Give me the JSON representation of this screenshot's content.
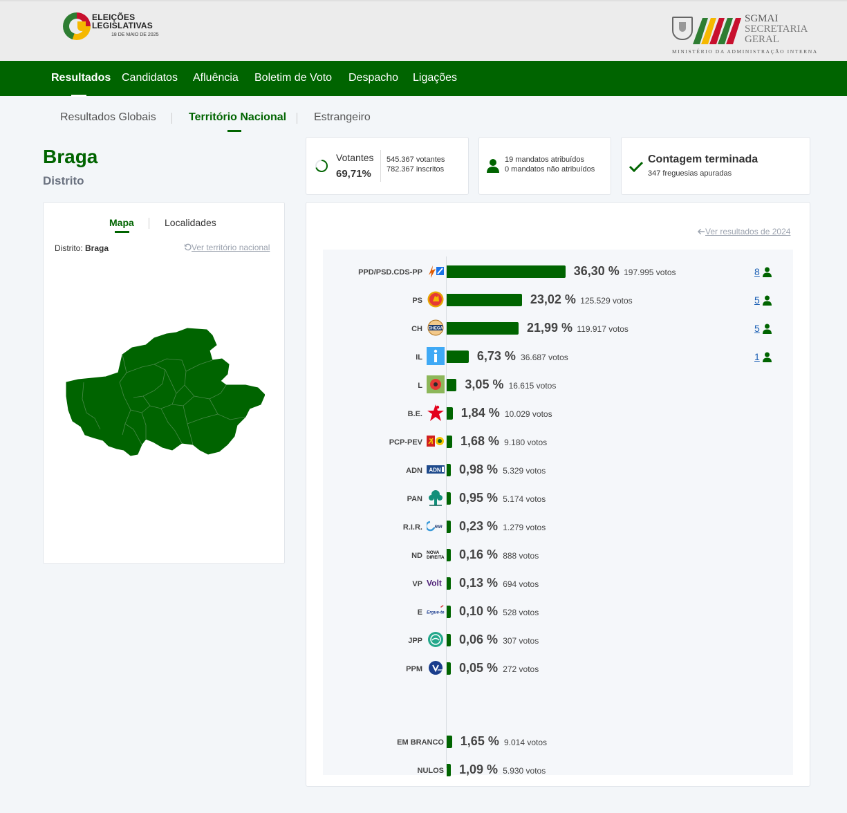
{
  "header": {
    "logo_line1": "ELEIÇÕES",
    "logo_line2": "LEGISLATIVAS",
    "logo_date": "18 DE MAIO DE 2025",
    "org_short": "SGMAI",
    "org_line2": "SECRETARIA",
    "org_line3": "GERAL",
    "org_ministry": "MINISTÉRIO DA ADMINISTRAÇÃO INTERNA"
  },
  "nav": {
    "items": [
      "Resultados",
      "Candidatos",
      "Afluência",
      "Boletim de Voto",
      "Despacho",
      "Ligações"
    ],
    "active": "Resultados"
  },
  "subtabs": {
    "items": [
      "Resultados Globais",
      "Território Nacional",
      "Estrangeiro"
    ],
    "active": "Território Nacional"
  },
  "region": {
    "title": "Braga",
    "subtitle": "Distrito"
  },
  "stats": {
    "votantes_label": "Votantes",
    "votantes_pct": "69,71%",
    "votantes_count": "545.367 votantes",
    "inscritos_count": "782.367 inscritos",
    "mandatos_atribuidos": "19 mandatos atribuídos",
    "mandatos_nao_atribuidos": "0 mandatos não atribuídos",
    "contagem_title": "Contagem terminada",
    "contagem_sub": "347 freguesias apuradas"
  },
  "map_panel": {
    "tabs": [
      "Mapa",
      "Localidades"
    ],
    "active": "Mapa",
    "district_label": "Distrito:",
    "district_value": "Braga",
    "national_link": "Ver território nacional"
  },
  "results": {
    "link_2024": "Ver resultados de 2024",
    "parties": [
      {
        "name": "PPD/PSD.CDS-PP",
        "pct": 36.3,
        "pct_label": "36,30 %",
        "votes": "197.995 votos",
        "seats": "8",
        "logo": "psd-cds-logo"
      },
      {
        "name": "PS",
        "pct": 23.02,
        "pct_label": "23,02 %",
        "votes": "125.529 votos",
        "seats": "5",
        "logo": "ps-logo"
      },
      {
        "name": "CH",
        "pct": 21.99,
        "pct_label": "21,99 %",
        "votes": "119.917 votos",
        "seats": "5",
        "logo": "chega-logo"
      },
      {
        "name": "IL",
        "pct": 6.73,
        "pct_label": "6,73 %",
        "votes": "36.687 votos",
        "seats": "1",
        "logo": "il-logo"
      },
      {
        "name": "L",
        "pct": 3.05,
        "pct_label": "3,05 %",
        "votes": "16.615 votos",
        "seats": "",
        "logo": "livre-logo"
      },
      {
        "name": "B.E.",
        "pct": 1.84,
        "pct_label": "1,84 %",
        "votes": "10.029 votos",
        "seats": "",
        "logo": "be-logo"
      },
      {
        "name": "PCP-PEV",
        "pct": 1.68,
        "pct_label": "1,68 %",
        "votes": "9.180 votos",
        "seats": "",
        "logo": "pcp-pev-logo"
      },
      {
        "name": "ADN",
        "pct": 0.98,
        "pct_label": "0,98 %",
        "votes": "5.329 votos",
        "seats": "",
        "logo": "adn-logo"
      },
      {
        "name": "PAN",
        "pct": 0.95,
        "pct_label": "0,95 %",
        "votes": "5.174 votos",
        "seats": "",
        "logo": "pan-logo"
      },
      {
        "name": "R.I.R.",
        "pct": 0.23,
        "pct_label": "0,23 %",
        "votes": "1.279 votos",
        "seats": "",
        "logo": "rir-logo"
      },
      {
        "name": "ND",
        "pct": 0.16,
        "pct_label": "0,16 %",
        "votes": "888 votos",
        "seats": "",
        "logo": "nd-logo"
      },
      {
        "name": "VP",
        "pct": 0.13,
        "pct_label": "0,13 %",
        "votes": "694 votos",
        "seats": "",
        "logo": "volt-logo"
      },
      {
        "name": "E",
        "pct": 0.1,
        "pct_label": "0,10 %",
        "votes": "528 votos",
        "seats": "",
        "logo": "ergue-te-logo"
      },
      {
        "name": "JPP",
        "pct": 0.06,
        "pct_label": "0,06 %",
        "votes": "307 votos",
        "seats": "",
        "logo": "jpp-logo"
      },
      {
        "name": "PPM",
        "pct": 0.05,
        "pct_label": "0,05 %",
        "votes": "272 votos",
        "seats": "",
        "logo": "ppm-logo"
      }
    ],
    "others": [
      {
        "name": "EM BRANCO",
        "pct": 1.65,
        "pct_label": "1,65 %",
        "votes": "9.014 votos"
      },
      {
        "name": "NULOS",
        "pct": 1.09,
        "pct_label": "1,09 %",
        "votes": "5.930 votos"
      }
    ],
    "logo_texts": {
      "adn": "ADN",
      "rir": "RIR",
      "nd1": "NOVA",
      "nd2": "DIREITA",
      "volt": "Volt",
      "ergue": "Ergue-te",
      "ppm": "PPM",
      "chega": "CHEGA"
    }
  },
  "colors": {
    "primary": "#006400",
    "link": "#1a5fb4",
    "muted": "#9ca3af"
  }
}
